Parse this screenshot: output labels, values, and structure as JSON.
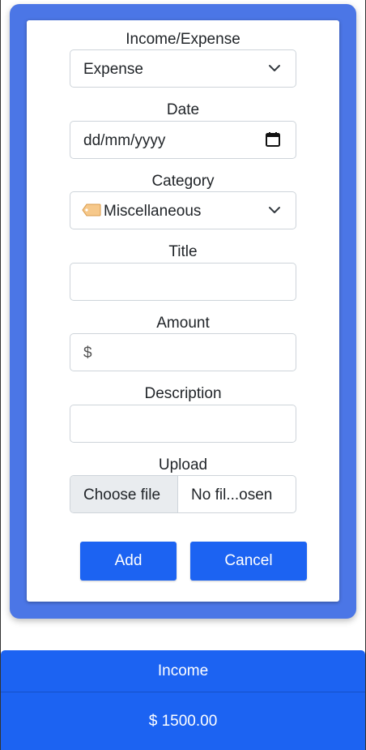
{
  "form": {
    "type": {
      "label": "Income/Expense",
      "value": "Expense"
    },
    "date": {
      "label": "Date",
      "placeholder": "dd/mm/yyyy"
    },
    "category": {
      "label": "Category",
      "icon": "tag-icon",
      "value": "Miscellaneous"
    },
    "title": {
      "label": "Title",
      "value": ""
    },
    "amount": {
      "label": "Amount",
      "prefix": "$",
      "value": ""
    },
    "description": {
      "label": "Description",
      "value": ""
    },
    "upload": {
      "label": "Upload",
      "button": "Choose file",
      "file_name": "No fil...osen"
    },
    "buttons": {
      "add": "Add",
      "cancel": "Cancel"
    }
  },
  "summary": {
    "title": "Income",
    "value": "$ 1500.00"
  },
  "colors": {
    "card": "#4b76e6",
    "primary": "#1c63f2"
  }
}
